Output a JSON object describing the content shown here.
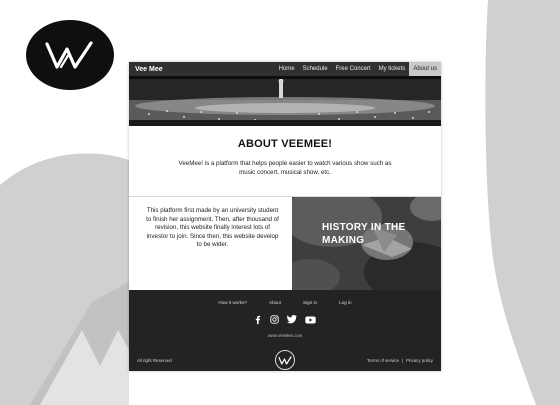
{
  "brand": "Vee Mee",
  "nav": {
    "items": [
      {
        "label": "Home",
        "active": false
      },
      {
        "label": "Schedule",
        "active": false
      },
      {
        "label": "Free Concert",
        "active": false
      },
      {
        "label": "My tickets",
        "active": false
      },
      {
        "label": "About us",
        "active": true
      }
    ]
  },
  "about": {
    "title": "ABOUT VEEMEE!",
    "text": "VeeMee! is a platform that helps people easier to watch various show such as music concert, musical show, etc."
  },
  "history": {
    "text": "This platform first made by an university student to finish her assignment. Then, after thousand of revision, this website finally interest lots of investor to join. Since then, this website develop to be wider.",
    "title_line1": "HISTORY IN THE",
    "title_line2": "MAKING"
  },
  "footer": {
    "links": [
      "How it works?",
      "About",
      "Sign in",
      "Log in"
    ],
    "social": [
      "facebook-icon",
      "instagram-icon",
      "twitter-icon",
      "youtube-icon"
    ],
    "url": "www.VeeMee.com",
    "copyright": "All right Reserved",
    "terms": "Terms of service",
    "privacy": "Privacy policy"
  },
  "colors": {
    "nav_bg": "#303030",
    "nav_active": "#c9c9c9",
    "footer_bg": "#232323",
    "bg_shape": "#d0d0d0",
    "logo": "#0f0f0f"
  }
}
